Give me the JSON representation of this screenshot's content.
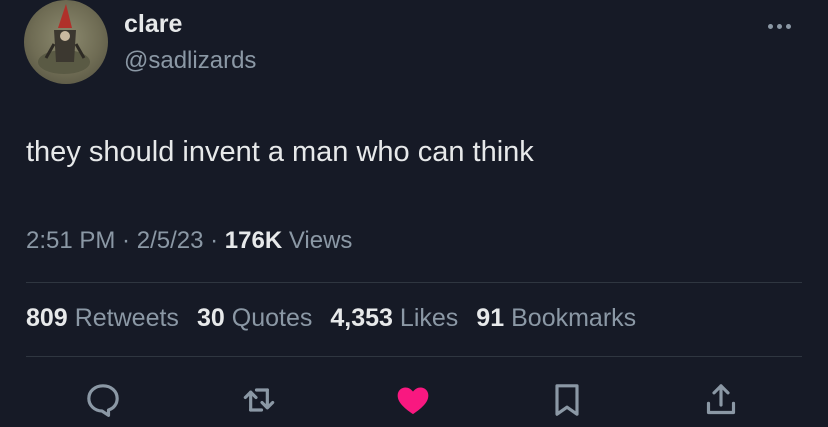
{
  "author": {
    "name": "clare",
    "handle": "@sadlizards"
  },
  "tweet": {
    "text": "they should invent a man who can think"
  },
  "meta": {
    "time": "2:51 PM",
    "sep1": " · ",
    "date": "2/5/23",
    "sep2": " · ",
    "views_count": "176K",
    "views_label": " Views"
  },
  "stats": [
    {
      "count": "809",
      "label": "Retweets"
    },
    {
      "count": "30",
      "label": "Quotes"
    },
    {
      "count": "4,353",
      "label": "Likes"
    },
    {
      "count": "91",
      "label": "Bookmarks"
    }
  ],
  "colors": {
    "background": "#161a26",
    "primary_text": "#e7e9ea",
    "secondary_text": "#8b98a5",
    "like_active": "#f91880"
  },
  "icons": [
    "more-icon",
    "reply-icon",
    "retweet-icon",
    "like-icon",
    "bookmark-icon",
    "share-icon"
  ]
}
